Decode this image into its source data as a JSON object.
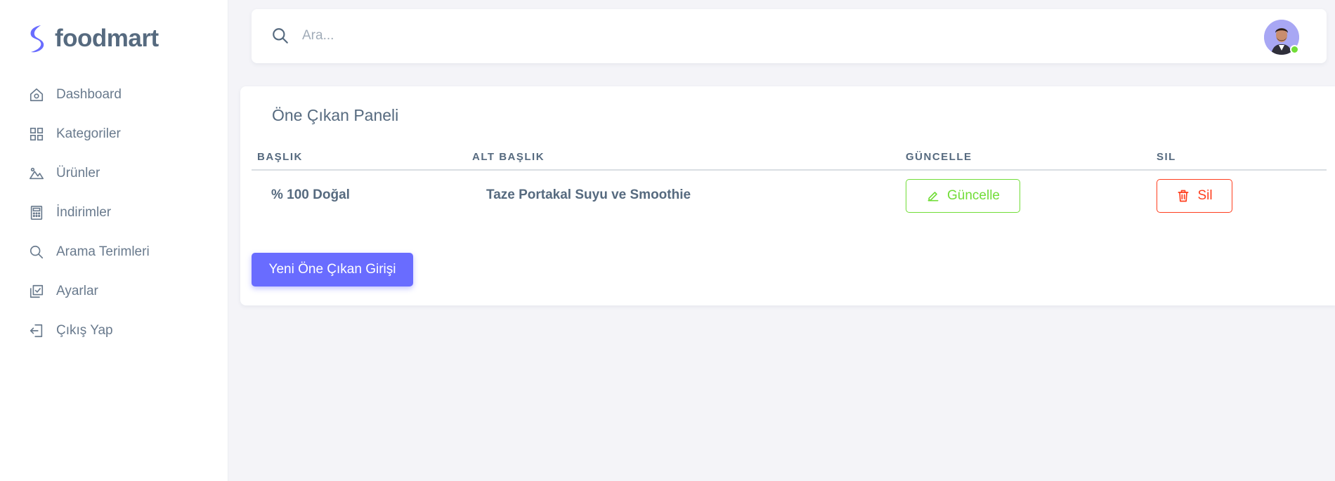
{
  "brand": {
    "name": "foodmart",
    "accent": "#696cff"
  },
  "sidebar": {
    "items": [
      {
        "label": "Dashboard",
        "icon": "home-icon"
      },
      {
        "label": "Kategoriler",
        "icon": "grid-icon"
      },
      {
        "label": "Ürünler",
        "icon": "image-icon"
      },
      {
        "label": "İndirimler",
        "icon": "calculator-icon"
      },
      {
        "label": "Arama Terimleri",
        "icon": "search-icon"
      },
      {
        "label": "Ayarlar",
        "icon": "checklist-icon"
      },
      {
        "label": "Çıkış Yap",
        "icon": "logout-icon"
      }
    ]
  },
  "search": {
    "placeholder": "Ara...",
    "value": ""
  },
  "user": {
    "status": "online",
    "status_color": "#71dd37"
  },
  "panel": {
    "title": "Öne Çıkan Paneli",
    "columns": [
      "BAŞLIK",
      "ALT BAŞLIK",
      "GÜNCELLE",
      "SIL"
    ],
    "rows": [
      {
        "title": "% 100 Doğal",
        "subtitle": "Taze Portakal Suyu ve Smoothie",
        "update_label": "Güncelle",
        "delete_label": "Sil"
      }
    ],
    "new_button_label": "Yeni Öne Çıkan Girişi"
  },
  "colors": {
    "success": "#71dd37",
    "danger": "#ff3e1d",
    "primary": "#696cff",
    "text": "#566a7f"
  }
}
